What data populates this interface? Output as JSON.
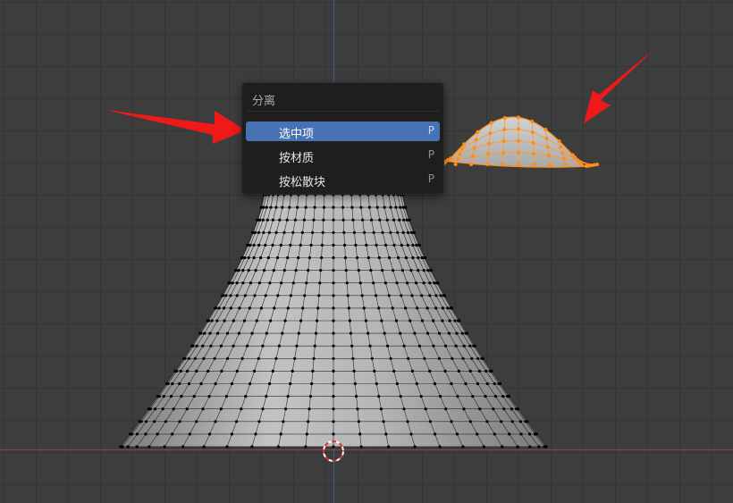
{
  "menu": {
    "title": "分离",
    "items": [
      {
        "label": "选中项",
        "shortcut": "P",
        "active": true
      },
      {
        "label": "按材质",
        "shortcut": "P",
        "active": false
      },
      {
        "label": "按松散块",
        "shortcut": "P",
        "active": false
      }
    ]
  },
  "colors": {
    "viewport_bg": "#3d3d3d",
    "grid": "#343434",
    "x_axis": "#9b3a44",
    "z_axis": "#3a5f8c",
    "menu_bg": "#1e1e1e",
    "menu_highlight": "#4772b3",
    "mesh": "#b9b9b9",
    "selected": "#ff8c1a",
    "arrow": "#ee1a1a"
  },
  "icons": [
    "3d-cursor-icon",
    "arrow-annotation"
  ]
}
